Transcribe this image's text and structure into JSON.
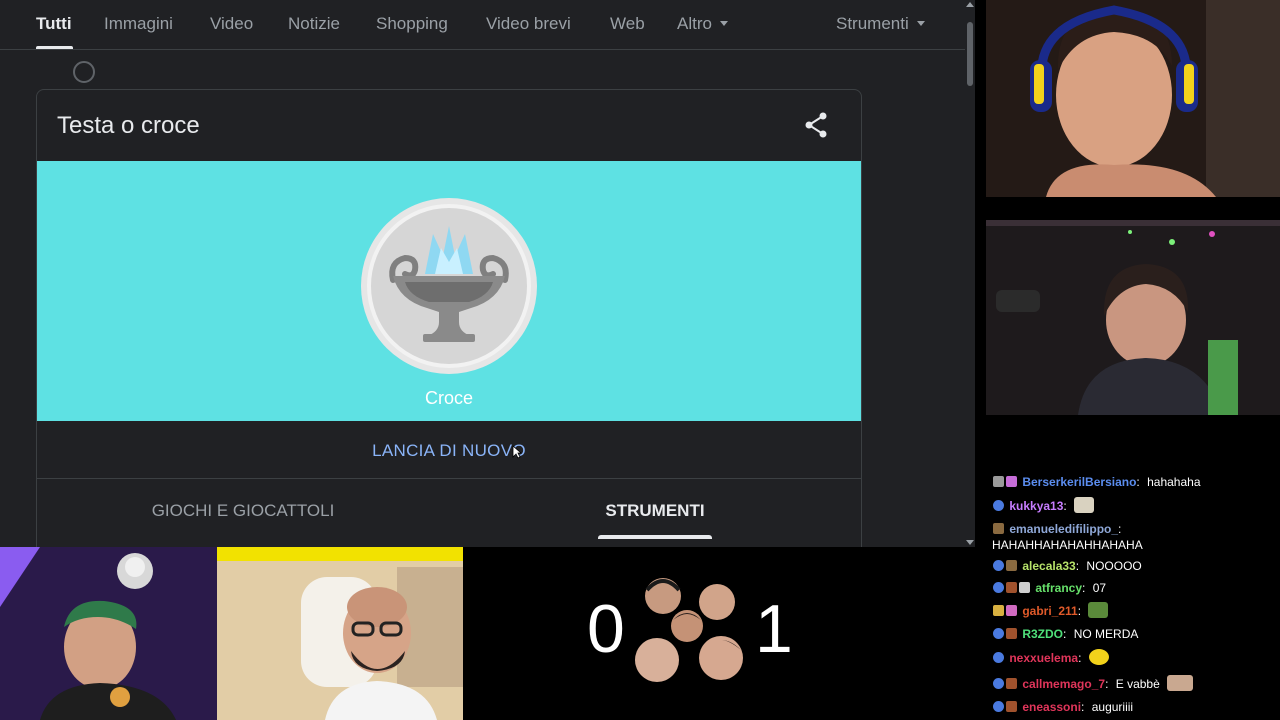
{
  "search_tabs": {
    "all": "Tutti",
    "images": "Immagini",
    "video": "Video",
    "news": "Notizie",
    "shopping": "Shopping",
    "short_videos": "Video brevi",
    "web": "Web",
    "more": "Altro",
    "tools": "Strumenti"
  },
  "card": {
    "title": "Testa o croce",
    "result": "Croce",
    "flip_again": "LANCIA DI NUOVO",
    "category_tabs": [
      "GIOCHI E GIOCATTOLI",
      "STRUMENTI"
    ],
    "active_category": "STRUMENTI"
  },
  "scoreboard": {
    "left_score": "0",
    "right_score": "1"
  },
  "chat": [
    {
      "user": "BerserkerilBersiano",
      "color": "#5b8def",
      "message": "hahahaha"
    },
    {
      "user": "kukkya13",
      "color": "#c77dff",
      "message": ""
    },
    {
      "user": "emanueledifilippo_",
      "color": "#8fa8d8",
      "message": "HAHAHHAHAHAHHAHAHA"
    },
    {
      "user": "alecala33",
      "color": "#b7e36a",
      "message": "NOOOOO"
    },
    {
      "user": "atfrancy",
      "color": "#66e06a",
      "message": "07"
    },
    {
      "user": "gabri_211",
      "color": "#e05a2a",
      "message": ""
    },
    {
      "user": "R3ZDO",
      "color": "#4fe07a",
      "message": "NO MERDA"
    },
    {
      "user": "nexxuelema",
      "color": "#e0355a",
      "message": ""
    },
    {
      "user": "callmemago_7",
      "color": "#e0355a",
      "message": "E vabbè"
    },
    {
      "user": "eneassoni",
      "color": "#e0355a",
      "message": "auguriiii"
    }
  ],
  "colors": {
    "coin_bg": "#5ee1e3",
    "link_blue": "#8ab4f8",
    "page_bg": "#202124"
  }
}
